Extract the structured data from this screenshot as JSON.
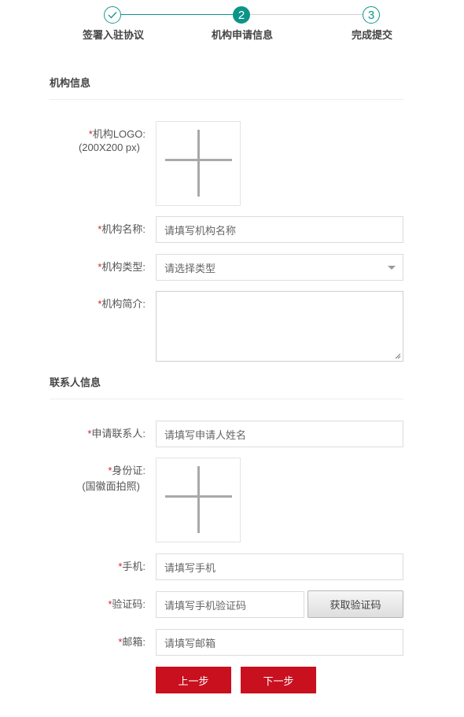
{
  "steps": [
    {
      "label": "签署入驻协议",
      "status": "done",
      "number": "1"
    },
    {
      "label": "机构申请信息",
      "status": "active",
      "number": "2"
    },
    {
      "label": "完成提交",
      "status": "todo",
      "number": "3"
    }
  ],
  "sections": {
    "org_title": "机构信息",
    "contact_title": "联系人信息"
  },
  "required_mark": "*",
  "org": {
    "logo_label": "机构LOGO:",
    "logo_size_hint": "(200X200 px)",
    "name_label": "机构名称:",
    "name_placeholder": "请填写机构名称",
    "type_label": "机构类型:",
    "type_placeholder": "请选择类型",
    "intro_label": "机构简介:"
  },
  "contact": {
    "applicant_label": "申请联系人:",
    "applicant_placeholder": "请填写申请人姓名",
    "id_label": "身份证:",
    "id_hint": "(国徽面拍照)",
    "phone_label": "手机:",
    "phone_placeholder": "请填写手机",
    "code_label": "验证码:",
    "code_placeholder": "请填写手机验证码",
    "get_code_button": "获取验证码",
    "email_label": "邮箱:",
    "email_placeholder": "请填写邮箱"
  },
  "actions": {
    "prev": "上一步",
    "next": "下一步"
  },
  "colors": {
    "accent": "#0d9488",
    "primary_button": "#c8101f",
    "required": "#d0232e"
  }
}
